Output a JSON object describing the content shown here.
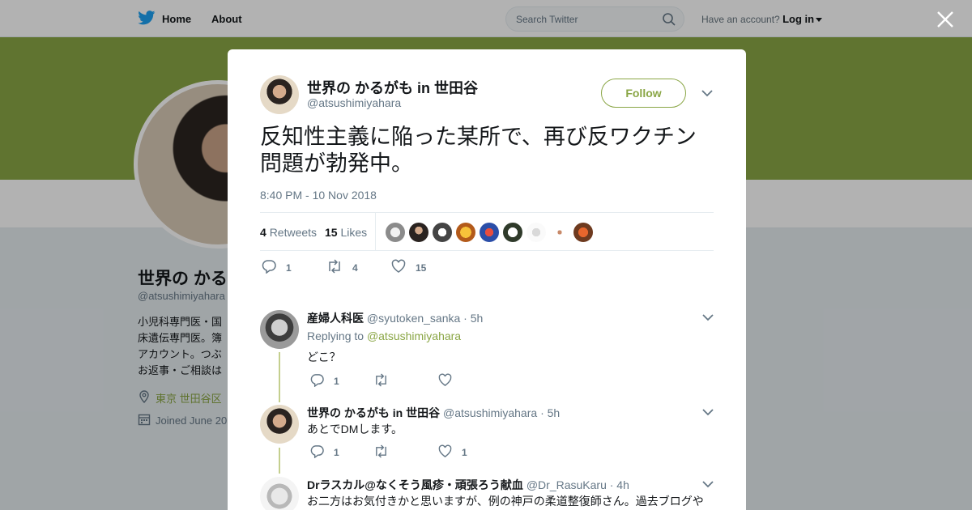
{
  "topbar": {
    "home_label": "Home",
    "about_label": "About",
    "search_placeholder": "Search Twitter",
    "account_prompt": "Have an account?",
    "login_label": "Log in"
  },
  "profile": {
    "name": "世界の かるがも in 世田谷",
    "handle": "@atsushimiyahara",
    "bio_lines": [
      "小児科専門医・国",
      "床遺伝専門医。簿",
      "アカウント。つぶ",
      "お返事・ご相談は"
    ],
    "location": "東京 世田谷区",
    "joined": "Joined June 20"
  },
  "tweet": {
    "author_name": "世界の かるがも in 世田谷",
    "author_handle": "@atsushimiyahara",
    "follow_label": "Follow",
    "text": "反知性主義に陥った某所で、再び反ワクチン問題が勃発中。",
    "timestamp": "8:40 PM - 10 Nov 2018",
    "retweets_count": "4",
    "retweets_label": "Retweets",
    "likes_count": "15",
    "likes_label": "Likes",
    "reply_count": "1",
    "retweet_action_count": "4",
    "like_action_count": "15"
  },
  "replies": [
    {
      "name": "産婦人科医",
      "handle": "@syutoken_sanka",
      "time": "· 5h",
      "replying_prefix": "Replying to",
      "replying_to": "@atsushimiyahara",
      "text": "どこ？",
      "reply_count": "1",
      "retweet_count": "",
      "like_count": ""
    },
    {
      "name": "世界の かるがも in 世田谷",
      "handle": "@atsushimiyahara",
      "time": "· 5h",
      "text": "あとでDMします。",
      "reply_count": "1",
      "retweet_count": "",
      "like_count": "1"
    },
    {
      "name": "Drラスカル@なくそう風疹・頑張ろう献血",
      "handle": "@Dr_RasuKaru",
      "time": "· 4h",
      "text": "お二方はお気付きかと思いますが、例の神戸の柔道整復師さん。過去ブログや"
    }
  ],
  "colors": {
    "accent": "#8aa645",
    "twitter_blue": "#1da1f2",
    "thread_line": "#c4cf8e",
    "muted_text": "#657786"
  },
  "icons": [
    "twitter-bird-icon",
    "search-icon",
    "close-icon",
    "chevron-down-icon",
    "reply-icon",
    "retweet-icon",
    "heart-icon",
    "location-pin-icon",
    "calendar-icon"
  ]
}
